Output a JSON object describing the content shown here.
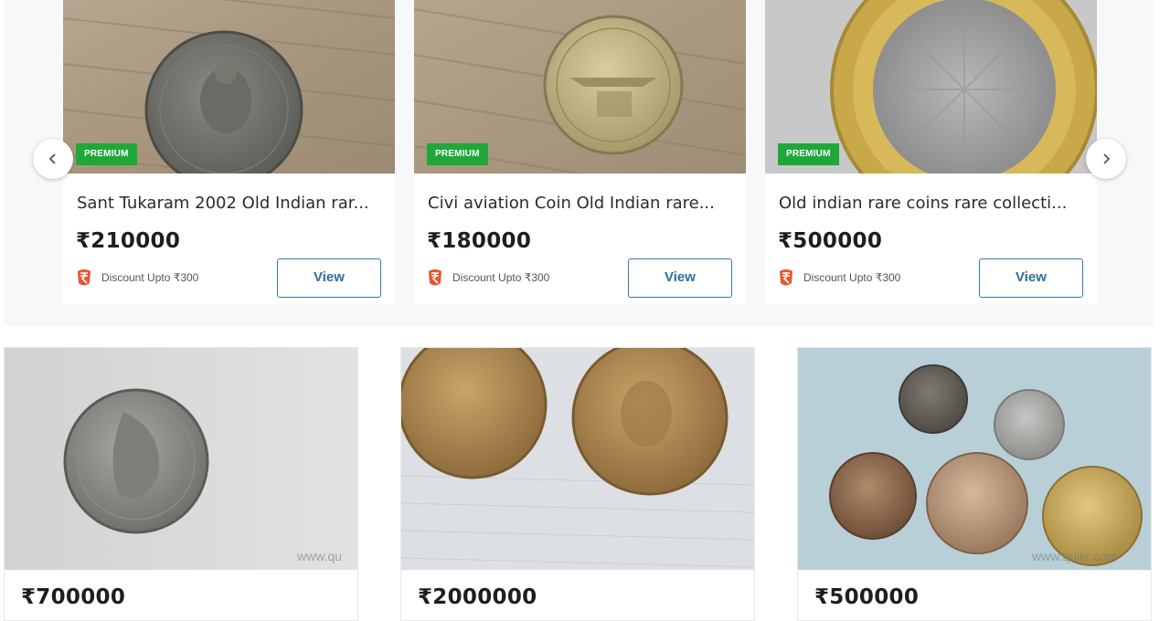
{
  "carousel": {
    "prev_icon": "chevron-left-icon",
    "next_icon": "chevron-right-icon",
    "cards": [
      {
        "badge": "PREMIUM",
        "title": "Sant Tukaram 2002 Old Indian rar...",
        "price": "₹210000",
        "discount": "Discount Upto ₹300",
        "view_label": "View"
      },
      {
        "badge": "PREMIUM",
        "title": "Civi aviation Coin Old Indian rare...",
        "price": "₹180000",
        "discount": "Discount Upto ₹300",
        "view_label": "View"
      },
      {
        "badge": "PREMIUM",
        "title": "Old indian rare coins rare collecti...",
        "price": "₹500000",
        "discount": "Discount Upto ₹300",
        "view_label": "View"
      }
    ]
  },
  "listings": [
    {
      "price": "₹700000",
      "watermark": "www.qu"
    },
    {
      "price": "₹2000000",
      "watermark": ""
    },
    {
      "price": "₹500000",
      "watermark": "www.quikr.com"
    }
  ],
  "colors": {
    "premium_badge": "#1fa83a",
    "view_button_border": "#2c7ea8",
    "discount_icon": "#e8552e"
  }
}
